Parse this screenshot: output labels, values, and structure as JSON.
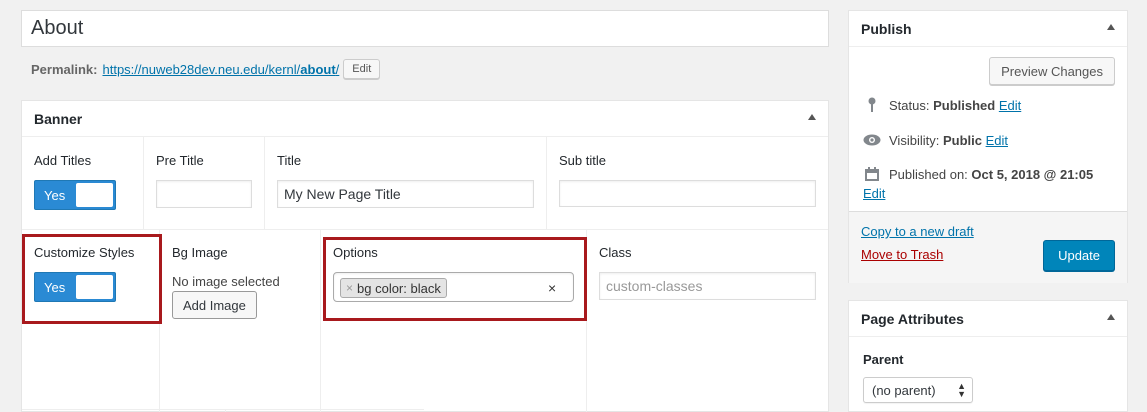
{
  "post_title": "About",
  "permalink": {
    "label": "Permalink:",
    "url_prefix": "https://nuweb28dev.neu.edu/kernl/",
    "slug": "about",
    "url_suffix": "/",
    "edit_label": "Edit"
  },
  "banner": {
    "heading": "Banner",
    "add_titles": {
      "label": "Add Titles",
      "toggle": "Yes"
    },
    "pre_title": {
      "label": "Pre Title",
      "value": ""
    },
    "title": {
      "label": "Title",
      "value": "My New Page Title"
    },
    "sub_title": {
      "label": "Sub title",
      "value": ""
    },
    "customize_styles": {
      "label": "Customize Styles",
      "toggle": "Yes"
    },
    "bg_image": {
      "label": "Bg Image",
      "status": "No image selected",
      "button": "Add Image"
    },
    "options": {
      "label": "Options",
      "tag": "bg color: black",
      "tag_remove": "×",
      "clear": "×"
    },
    "class": {
      "label": "Class",
      "placeholder": "custom-classes"
    }
  },
  "publish": {
    "heading": "Publish",
    "preview_button": "Preview Changes",
    "status_label": "Status:",
    "status_value": "Published",
    "visibility_label": "Visibility:",
    "visibility_value": "Public",
    "published_on_label": "Published on:",
    "published_on_value": "Oct 5, 2018 @ 21:05",
    "edit_link": "Edit",
    "copy_draft": "Copy to a new draft",
    "move_trash": "Move to Trash",
    "update_button": "Update"
  },
  "page_attributes": {
    "heading": "Page Attributes",
    "parent_label": "Parent",
    "parent_value": "(no parent)"
  },
  "colors": {
    "highlight": "#a8191d",
    "toggle_on": "#2a8ad4",
    "primary_button": "#0085ba",
    "link": "#0073aa",
    "trash": "#a00000"
  }
}
